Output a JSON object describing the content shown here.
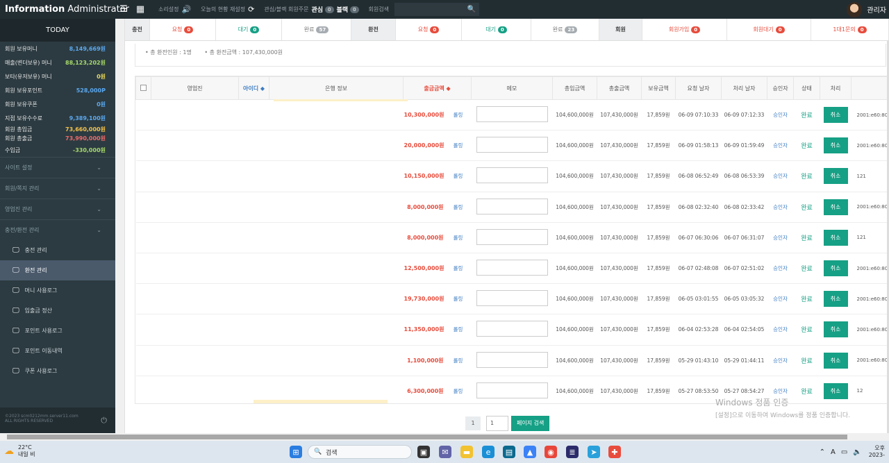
{
  "header": {
    "brand_bold": "Information",
    "brand_light": "Administrator",
    "sound_label": "소리설정",
    "today_status_label": "오늘의 현황 재설정",
    "watch_label": "관심/블랙 회원주문",
    "watch_name": "관심",
    "watch_count": "0",
    "black_name": "블랙",
    "black_count": "0",
    "member_search_label": "회원검색",
    "user_name": "관리자"
  },
  "sidebar": {
    "today": "TODAY",
    "stats": [
      {
        "label": "회원 보유머니",
        "value": "8,149,669원",
        "color": "#5aa8f0"
      },
      {
        "label": "매출(변더보유) 머니",
        "value": "88,123,202원",
        "color": "#a6d96a"
      },
      {
        "label": "보타(유저보유) 머니",
        "value": "0원",
        "color": "#e8d85a"
      },
      {
        "label": "회원 보유포인트",
        "value": "528,000P",
        "color": "#5aa8f0"
      },
      {
        "label": "회원 보유쿠폰",
        "value": "0원",
        "color": "#5aa8f0"
      },
      {
        "label": "지점 보유수수료",
        "value": "9,389,100원",
        "color": "#5aa8f0"
      },
      {
        "label": "회원 총입금",
        "value": "73,660,000원",
        "color": "#f5c24a"
      },
      {
        "label": "회원 총출금",
        "value": "73,990,000원",
        "color": "#f06a6a"
      },
      {
        "label": "수입금",
        "value": "-330,000원",
        "color": "#a6d96a"
      }
    ],
    "menus": [
      "사이트 설정",
      "회원/쪽지 관리",
      "영업진 관리",
      "충전/환전 관리"
    ],
    "subs": [
      "충전 관리",
      "환전 관리",
      "머니 사용로그",
      "입출금 정산",
      "포인트 사용로그",
      "포인트 이동내역",
      "쿠폰 사용로그"
    ],
    "active_sub": 1,
    "footer_line1": "©2023 scm0212mm.server11.com",
    "footer_line2": "ALL RIGHTS RESERVED"
  },
  "tabs": [
    {
      "label": "충전",
      "kind": "head",
      "w": 36
    },
    {
      "label": "요청",
      "kind": "red",
      "badge": "0",
      "bcolor": "b-red",
      "w": 95
    },
    {
      "label": "대기",
      "kind": "teal",
      "badge": "0",
      "bcolor": "b-teal",
      "w": 95
    },
    {
      "label": "완료",
      "kind": "gray",
      "badge": "57",
      "bcolor": "b-gray",
      "w": 100
    },
    {
      "label": "환전",
      "kind": "head",
      "w": 64
    },
    {
      "label": "요청",
      "kind": "red",
      "badge": "0",
      "bcolor": "b-red",
      "w": 95
    },
    {
      "label": "대기",
      "kind": "teal",
      "badge": "0",
      "bcolor": "b-teal",
      "w": 100
    },
    {
      "label": "완료",
      "kind": "gray",
      "badge": "23",
      "bcolor": "b-gray",
      "w": 98
    },
    {
      "label": "회원",
      "kind": "head",
      "w": 62
    },
    {
      "label": "회원가입",
      "kind": "red",
      "badge": "0",
      "bcolor": "b-red",
      "w": 122
    },
    {
      "label": "회원대기",
      "kind": "red",
      "badge": "0",
      "bcolor": "b-red",
      "w": 121
    },
    {
      "label": "1대1문의",
      "kind": "red",
      "badge": "0",
      "bcolor": "b-red",
      "w": 112
    }
  ],
  "summary": {
    "count_label": "• 총 환전인원 : 1명",
    "amount_label": "• 총 환전금액 : 107,430,000원"
  },
  "table": {
    "headers": [
      "",
      "영업진",
      "아이디 ◆",
      "은행 정보",
      "출금금액 ◆",
      "메모",
      "총입금액",
      "총출금액",
      "보유금액",
      "요청 날자",
      "처리 날자",
      "승인자",
      "상태",
      "처리",
      ""
    ],
    "rows": [
      {
        "amount": "10,300,000원",
        "kind": "롤링",
        "dep": "104,600,000원",
        "wd": "107,430,000원",
        "bal": "17,859원",
        "req": "06-09 07:10:33",
        "done": "06-09 07:12:33",
        "approver": "승인자",
        "status": "완료",
        "action": "취소",
        "ip": "2001:e60:8013:4"
      },
      {
        "amount": "20,000,000원",
        "kind": "롤링",
        "dep": "104,600,000원",
        "wd": "107,430,000원",
        "bal": "17,859원",
        "req": "06-09 01:58:13",
        "done": "06-09 01:59:49",
        "approver": "승인자",
        "status": "완료",
        "action": "취소",
        "ip": "2001:e60:8013:4"
      },
      {
        "amount": "10,150,000원",
        "kind": "롤링",
        "dep": "104,600,000원",
        "wd": "107,430,000원",
        "bal": "17,859원",
        "req": "06-08 06:52:49",
        "done": "06-08 06:53:39",
        "approver": "승인자",
        "status": "완료",
        "action": "취소",
        "ip": "121"
      },
      {
        "amount": "8,000,000원",
        "kind": "롤링",
        "dep": "104,600,000원",
        "wd": "107,430,000원",
        "bal": "17,859원",
        "req": "06-08 02:32:40",
        "done": "06-08 02:33:42",
        "approver": "승인자",
        "status": "완료",
        "action": "취소",
        "ip": "2001:e60:8013:4"
      },
      {
        "amount": "8,000,000원",
        "kind": "롤링",
        "dep": "104,600,000원",
        "wd": "107,430,000원",
        "bal": "17,859원",
        "req": "06-07 06:30:06",
        "done": "06-07 06:31:07",
        "approver": "승인자",
        "status": "완료",
        "action": "취소",
        "ip": "121"
      },
      {
        "amount": "12,500,000원",
        "kind": "롤링",
        "dep": "104,600,000원",
        "wd": "107,430,000원",
        "bal": "17,859원",
        "req": "06-07 02:48:08",
        "done": "06-07 02:51:02",
        "approver": "승인자",
        "status": "완료",
        "action": "취소",
        "ip": "2001:e60:8018:10"
      },
      {
        "amount": "19,730,000원",
        "kind": "롤링",
        "dep": "104,600,000원",
        "wd": "107,430,000원",
        "bal": "17,859원",
        "req": "06-05 03:01:55",
        "done": "06-05 03:05:32",
        "approver": "승인자",
        "status": "완료",
        "action": "취소",
        "ip": "2001:e60:8018:18"
      },
      {
        "amount": "11,350,000원",
        "kind": "롤링",
        "dep": "104,600,000원",
        "wd": "107,430,000원",
        "bal": "17,859원",
        "req": "06-04 02:53:28",
        "done": "06-04 02:54:05",
        "approver": "승인자",
        "status": "완료",
        "action": "취소",
        "ip": "2001:e60:8018:18"
      },
      {
        "amount": "1,100,000원",
        "kind": "롤링",
        "dep": "104,600,000원",
        "wd": "107,430,000원",
        "bal": "17,859원",
        "req": "05-29 01:43:10",
        "done": "05-29 01:44:11",
        "approver": "승인자",
        "status": "완료",
        "action": "취소",
        "ip": "2001:e60:8017:40"
      },
      {
        "amount": "6,300,000원",
        "kind": "롤링",
        "dep": "104,600,000원",
        "wd": "107,430,000원",
        "bal": "17,859원",
        "req": "05-27 08:53:50",
        "done": "05-27 08:54:27",
        "approver": "승인자",
        "status": "완료",
        "action": "취소",
        "ip": "12"
      }
    ]
  },
  "pager": {
    "page": "1",
    "input": "1",
    "button": "페이지 검색"
  },
  "watermark": {
    "line1": "Windows 정품 인증",
    "line2": "[설정]으로 이동하여 Windows를 정품 인증합니다."
  },
  "taskbar": {
    "temp": "22°C",
    "weather": "내일 비",
    "search": "검색",
    "clock1": "오후",
    "clock2": "2023-"
  },
  "colors": {
    "accent": "#16a085",
    "danger": "#e74c3c",
    "link": "#3c7cc2",
    "sidebar": "#2c3b41"
  }
}
